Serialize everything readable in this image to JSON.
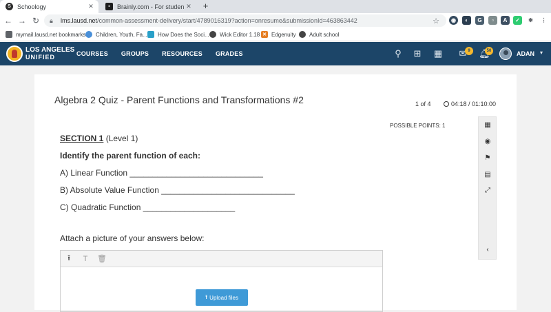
{
  "browser": {
    "tabs": [
      {
        "title": "Schoology",
        "icon": "schoology-favicon",
        "active": true
      },
      {
        "title": "Brainly.com - For students. By st",
        "icon": "brainly-favicon",
        "active": false
      }
    ],
    "new_tab": "+",
    "url_host": "lms.lausd.net",
    "url_path": "/common-assessment-delivery/start/4789016319?action=onresume&submissionId=463863442",
    "bookmarks": [
      {
        "label": "mymail.lausd.net bookmarks",
        "icon": "folder-icon"
      },
      {
        "label": "Children, Youth, Fa...",
        "icon": "globe-icon"
      },
      {
        "label": "How Does the Soci...",
        "icon": "brain-icon"
      },
      {
        "label": "Wick Editor 1.18",
        "icon": "wick-icon"
      },
      {
        "label": "Edgenuity",
        "icon": "edgenuity-icon"
      },
      {
        "label": "Adult school",
        "icon": "globe-icon"
      }
    ]
  },
  "site": {
    "logo_line1": "LOS ANGELES",
    "logo_line2": "UNIFIED",
    "nav": [
      "COURSES",
      "GROUPS",
      "RESOURCES",
      "GRADES"
    ],
    "messages_badge": "9",
    "notifications_badge": "50",
    "username": "ADAN",
    "brand_color": "#1c4568",
    "badge_color": "#f5b82e"
  },
  "quiz": {
    "title": "Algebra 2 Quiz - Parent Functions and Transformations #2",
    "page": "1 of 4",
    "timer": "04:18 / 01:10:00",
    "possible_points": "POSSIBLE POINTS: 1",
    "section": "SECTION 1",
    "level": " (Level 1)",
    "instruction": "Identify the parent function of each:",
    "items": [
      "A) Linear Function _____________________________",
      "B) Absolute Value Function _____________________________",
      "C) Quadratic Function ____________________"
    ],
    "attach_label": "Attach a picture of your answers below:",
    "upload_label": "Upload files"
  }
}
